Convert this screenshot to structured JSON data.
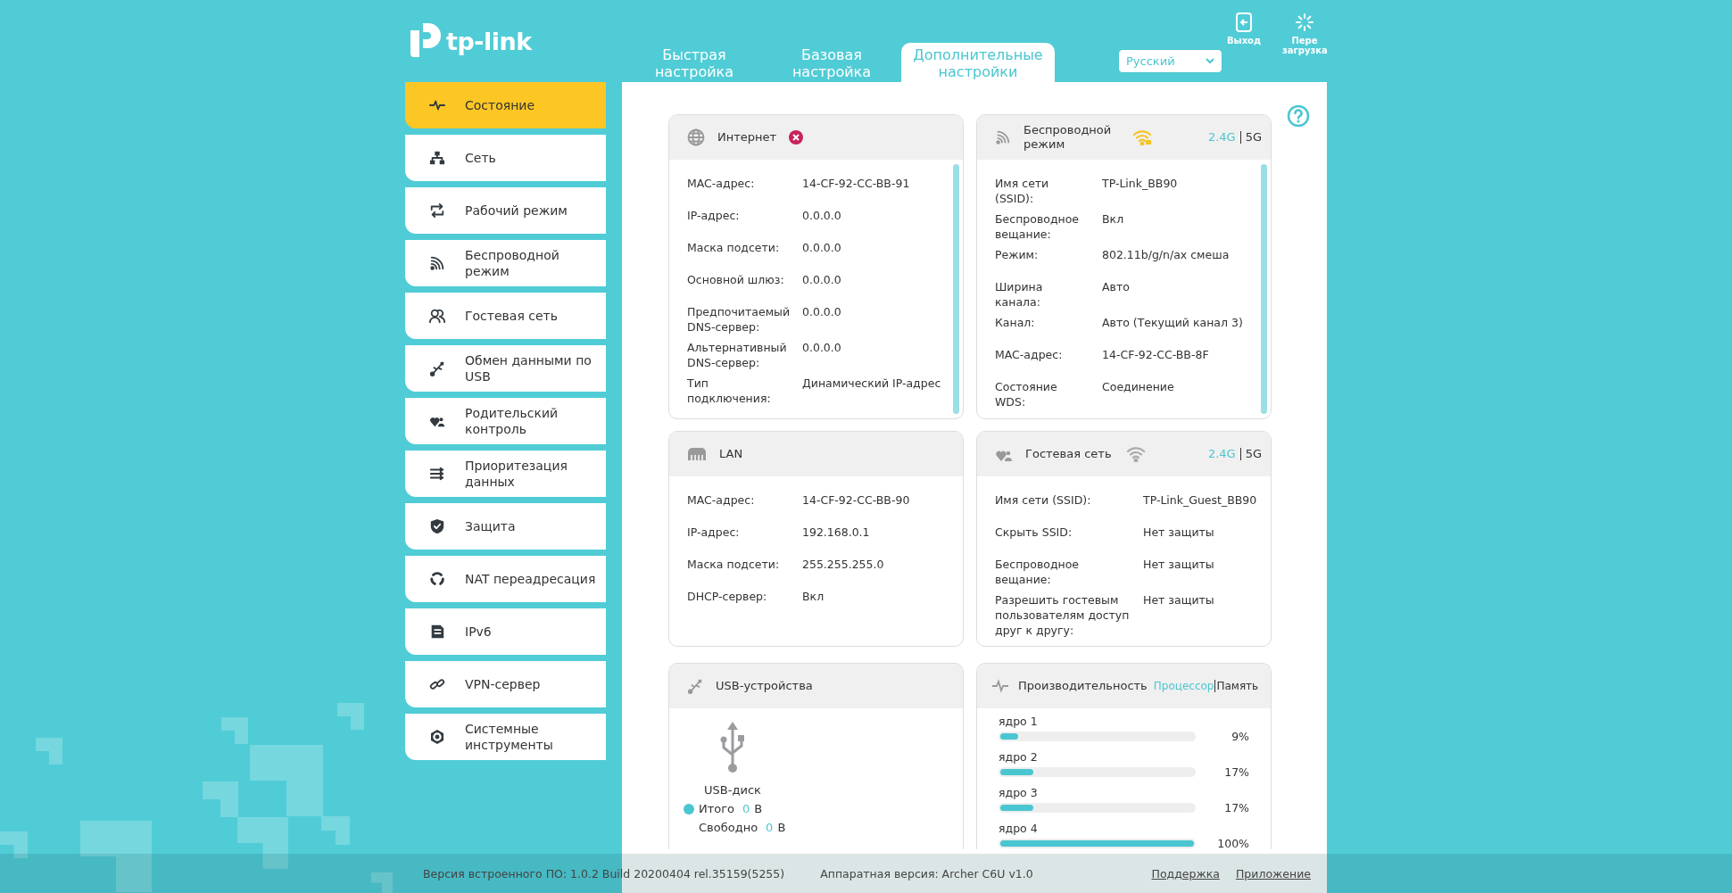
{
  "logo": {
    "text": "tp-link"
  },
  "tabs": [
    {
      "label": "Быстрая настройка",
      "selected": false
    },
    {
      "label": "Базовая настройка",
      "selected": false
    },
    {
      "label": "Дополнительные настройки",
      "selected": true
    }
  ],
  "language": {
    "value": "Русский"
  },
  "header_actions": [
    {
      "kind": "logout",
      "label": "Выход"
    },
    {
      "kind": "reboot",
      "label": "Пере загрузка"
    }
  ],
  "sidebar": {
    "items": [
      {
        "label": "Состояние",
        "selected": true
      },
      {
        "label": "Сеть",
        "selected": false
      },
      {
        "label": "Рабочий режим",
        "selected": false
      },
      {
        "label": "Беспроводной режим",
        "selected": false
      },
      {
        "label": "Гостевая сеть",
        "selected": false
      },
      {
        "label": "Обмен данными по USB",
        "selected": false
      },
      {
        "label": "Родительский контроль",
        "selected": false
      },
      {
        "label": "Приоритезация данных",
        "selected": false
      },
      {
        "label": "Защита",
        "selected": false
      },
      {
        "label": "NAT переадресация",
        "selected": false
      },
      {
        "label": "IPv6",
        "selected": false
      },
      {
        "label": "VPN-сервер",
        "selected": false
      },
      {
        "label": "Системные инструменты",
        "selected": false
      }
    ]
  },
  "internet_card": {
    "title": "Интернет",
    "connected": false,
    "rows": [
      {
        "label": "MAC-адрес:",
        "value": "14-CF-92-CC-BB-91"
      },
      {
        "label": "IP-адрес:",
        "value": "0.0.0.0"
      },
      {
        "label": "Маска подсети:",
        "value": "0.0.0.0"
      },
      {
        "label": "Основной шлюз:",
        "value": "0.0.0.0"
      },
      {
        "label": "Предпочитаемый DNS-сервер:",
        "value": "0.0.0.0"
      },
      {
        "label": "Альтернативный DNS-сервер:",
        "value": "0.0.0.0"
      },
      {
        "label": "Тип подключения:",
        "value": "Динамический IP-адрес"
      }
    ]
  },
  "wireless_card": {
    "title": "Беспроводной режим",
    "enabled": true,
    "bands": [
      {
        "label": "2.4G",
        "selected": true
      },
      {
        "label": "5G",
        "selected": false
      }
    ],
    "rows": [
      {
        "label": "Имя сети (SSID):",
        "value": "TP-Link_BB90"
      },
      {
        "label": "Беспроводное вещание:",
        "value": "Вкл"
      },
      {
        "label": "Режим:",
        "value": "802.11b/g/n/ax смеша"
      },
      {
        "label": "Ширина канала:",
        "value": "Авто"
      },
      {
        "label": "Канал:",
        "value": "Авто (Текущий канал 3)"
      },
      {
        "label": "MAC-адрес:",
        "value": "14-CF-92-CC-BB-8F"
      },
      {
        "label": "Состояние WDS:",
        "value": "Соединение"
      }
    ]
  },
  "lan_card": {
    "title": "LAN",
    "rows": [
      {
        "label": "MAC-адрес:",
        "value": "14-CF-92-CC-BB-90"
      },
      {
        "label": "IP-адрес:",
        "value": "192.168.0.1"
      },
      {
        "label": "Маска подсети:",
        "value": "255.255.255.0"
      },
      {
        "label": "DHCP-сервер:",
        "value": "Вкл"
      }
    ]
  },
  "guest_card": {
    "title": "Гостевая сеть",
    "enabled": false,
    "bands": [
      {
        "label": "2.4G",
        "selected": true
      },
      {
        "label": "5G",
        "selected": false
      }
    ],
    "rows": [
      {
        "label": "Имя сети (SSID):",
        "value": "TP-Link_Guest_BB90"
      },
      {
        "label": "Скрыть SSID:",
        "value": "Нет защиты"
      },
      {
        "label": "Беспроводное вещание:",
        "value": "Нет защиты"
      },
      {
        "label": "Разрешить гостевым пользователям доступ друг к другу:",
        "value": "Нет защиты"
      }
    ]
  },
  "usb_card": {
    "title": "USB-устройства",
    "device": "USB-диск",
    "stats": [
      {
        "label": "Итого",
        "value": "0",
        "unit": "В"
      },
      {
        "label": "Свободно",
        "value": "0",
        "unit": "В"
      }
    ]
  },
  "performance_card": {
    "title": "Производительность",
    "tabs": [
      {
        "label": "Процессор",
        "selected": true
      },
      {
        "label": "Память",
        "selected": false
      }
    ],
    "cores": [
      {
        "label": "ядро 1",
        "level": 0.09,
        "reading": "9%"
      },
      {
        "label": "ядро 2",
        "level": 0.17,
        "reading": "17%"
      },
      {
        "label": "ядро 3",
        "level": 0.17,
        "reading": "17%"
      },
      {
        "label": "ядро 4",
        "level": 1.0,
        "reading": "100%"
      }
    ]
  },
  "footer": {
    "firmware": "Версия встроенного ПО: 1.0.2 Build 20200404 rel.35159(5255)",
    "hardware": "Аппаратная версия: Archer C6U v1.0",
    "links": [
      "Поддержка",
      "Приложение"
    ]
  }
}
